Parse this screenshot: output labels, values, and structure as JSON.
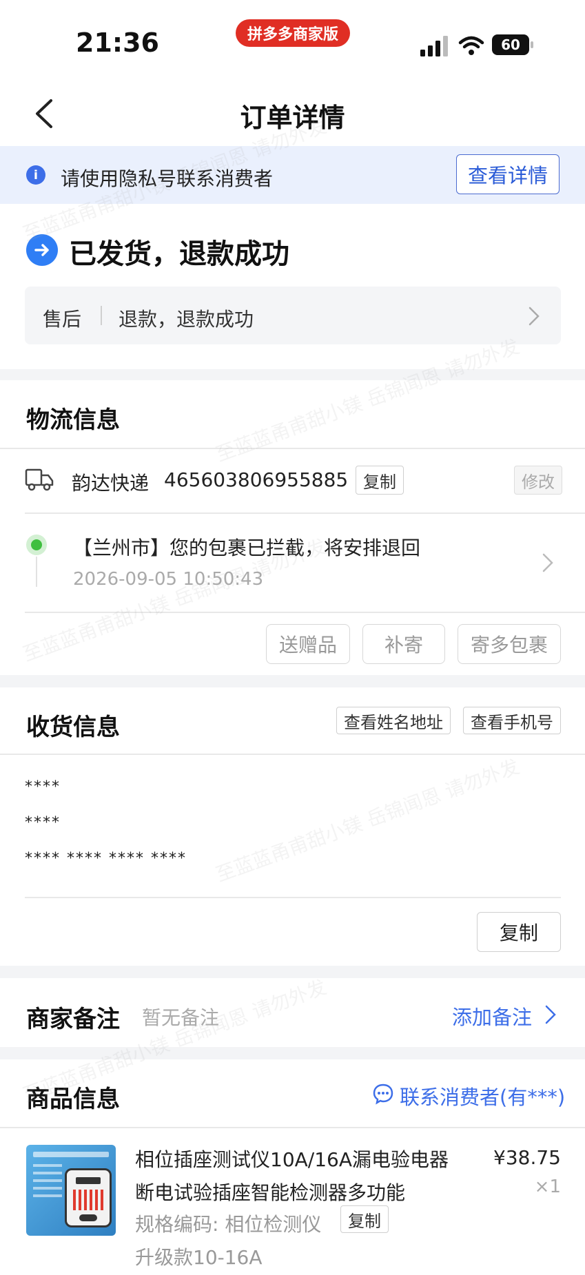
{
  "status_bar": {
    "time": "21:36",
    "app_badge": "拼多多商家版",
    "battery": "60"
  },
  "header": {
    "title": "订单详情"
  },
  "notice": {
    "text": "请使用隐私号联系消费者",
    "button": "查看详情"
  },
  "order_status": {
    "title": "已发货，退款成功"
  },
  "after_sale": {
    "label": "售后",
    "value": "退款，退款成功"
  },
  "logistics": {
    "title": "物流信息",
    "carrier": "韵达快递",
    "tracking_number": "465603806955885",
    "copy_label": "复制",
    "edit_label": "修改",
    "latest_event": "【兰州市】您的包裹已拦截，将安排退回",
    "latest_time": "2026-09-05 10:50:43",
    "actions": [
      "送赠品",
      "补寄",
      "寄多包裹"
    ]
  },
  "shipping": {
    "title": "收货信息",
    "view_name_address": "查看姓名地址",
    "view_phone": "查看手机号",
    "name": "****",
    "phone": "****",
    "address": "**** **** **** ****",
    "copy_label": "复制"
  },
  "merchant_note": {
    "title": "商家备注",
    "placeholder": "暂无备注",
    "add_label": "添加备注"
  },
  "product": {
    "title": "商品信息",
    "contact_label": "联系消费者(有***)",
    "name": "相位插座测试仪10A/16A漏电验电器断电试验插座智能检测器多功能",
    "spec_prefix": "规格编码: 相位检测仪",
    "spec_copy": "复制",
    "variant": "升级款10-16A",
    "price": "¥38.75",
    "qty": "×1"
  },
  "watermark": "至蓝蓝甬甫甜小镁 岳锦闻恩 请勿外发",
  "colors": {
    "accent_blue": "#2a5bd7",
    "brand_red": "#e02e24",
    "status_blue": "#2f7ef5",
    "green_dot": "#3fbf3f"
  }
}
